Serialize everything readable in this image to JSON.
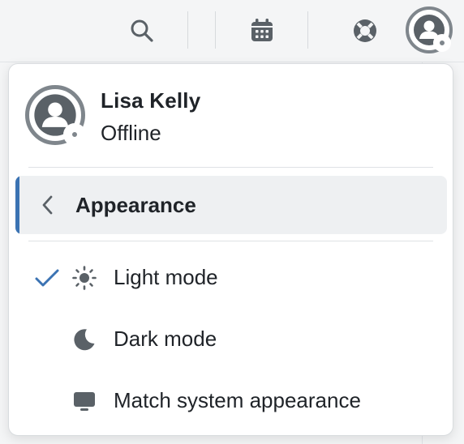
{
  "topbar": {
    "icons": [
      "search-icon",
      "calendar-icon",
      "help-lifebuoy-icon",
      "avatar-icon"
    ]
  },
  "user": {
    "name": "Lisa Kelly",
    "status": "Offline",
    "status_color": "#7f868c"
  },
  "menu": {
    "section_title": "Appearance",
    "back_icon": "chevron-left-icon",
    "accent_color": "#3b73b3",
    "options": [
      {
        "label": "Light mode",
        "icon": "sun-icon",
        "selected": true
      },
      {
        "label": "Dark mode",
        "icon": "moon-icon",
        "selected": false
      },
      {
        "label": "Match system appearance",
        "icon": "monitor-icon",
        "selected": false
      }
    ]
  }
}
